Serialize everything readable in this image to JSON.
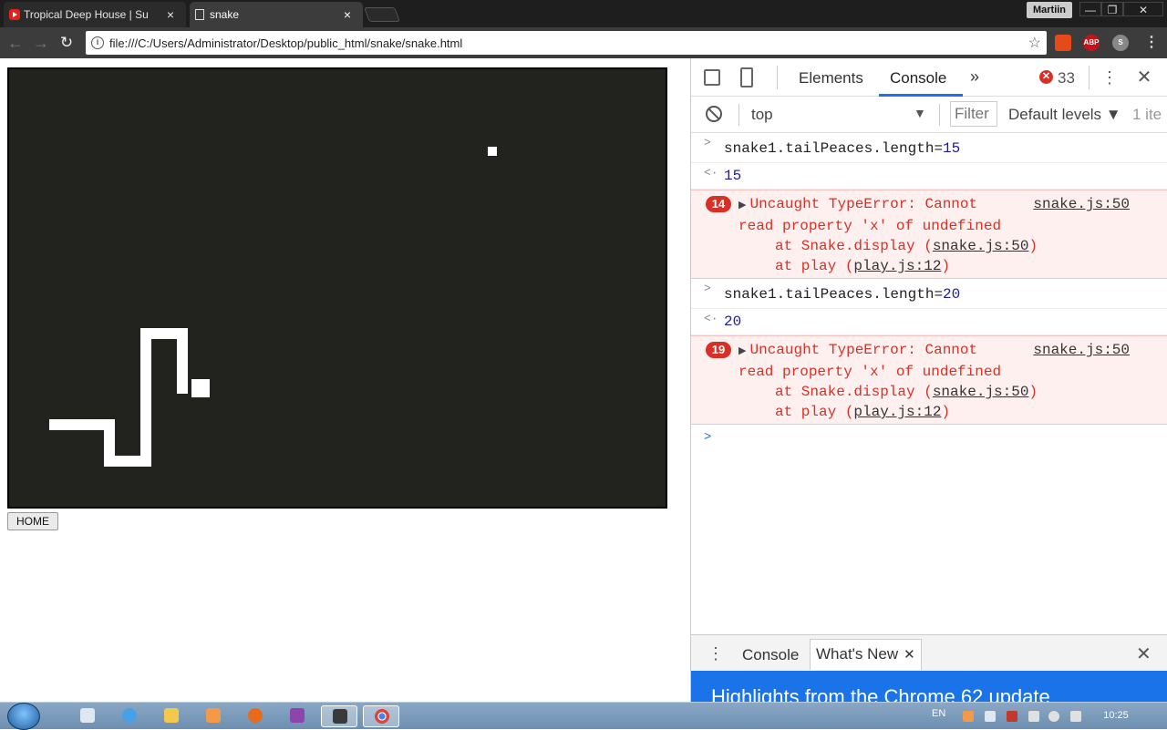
{
  "browser": {
    "tabs": [
      {
        "title": "Tropical Deep House | Su",
        "icon": "youtube-icon"
      },
      {
        "title": "snake",
        "icon": "page-icon"
      }
    ],
    "profile_name": "Martiin",
    "window_controls": {
      "minimize": "—",
      "maximize": "❐",
      "close": "✕"
    },
    "url": "file:///C:/Users/Administrator/Desktop/public_html/snake/snake.html",
    "extensions": {
      "abp": "ABP"
    }
  },
  "page": {
    "home_button": "HOME"
  },
  "devtools": {
    "tabs": {
      "elements": "Elements",
      "console": "Console"
    },
    "more_tabs": "»",
    "error_count": "33",
    "context": "top",
    "filter_placeholder": "Filter",
    "levels": "Default levels ▼",
    "hidden": "1 ite",
    "console": {
      "cmd1": "snake1.tailPeaces.length=",
      "cmd1_val": "15",
      "res1": "15",
      "err1": {
        "count": "14",
        "message": "Uncaught TypeError: Cannot",
        "message2": "read property 'x' of undefined",
        "source": "snake.js:50",
        "stack1_pre": "at Snake.display (",
        "stack1_link": "snake.js:50",
        "stack2_pre": "at play (",
        "stack2_link": "play.js:12"
      },
      "cmd2": "snake1.tailPeaces.length=",
      "cmd2_val": "20",
      "res2": "20",
      "err2": {
        "count": "19",
        "message": "Uncaught TypeError: Cannot",
        "message2": "read property 'x' of undefined",
        "source": "snake.js:50",
        "stack1_pre": "at Snake.display (",
        "stack1_link": "snake.js:50",
        "stack2_pre": "at play (",
        "stack2_link": "play.js:12"
      }
    },
    "drawer": {
      "console_tab": "Console",
      "whats_new_tab": "What's New",
      "highlights": "Highlights from the Chrome 62 update"
    }
  },
  "taskbar": {
    "language": "EN",
    "clock": "10:25"
  },
  "colors": {
    "canvas_bg": "#22221e",
    "error_red": "#d93025",
    "accent_blue": "#1a73e8"
  }
}
